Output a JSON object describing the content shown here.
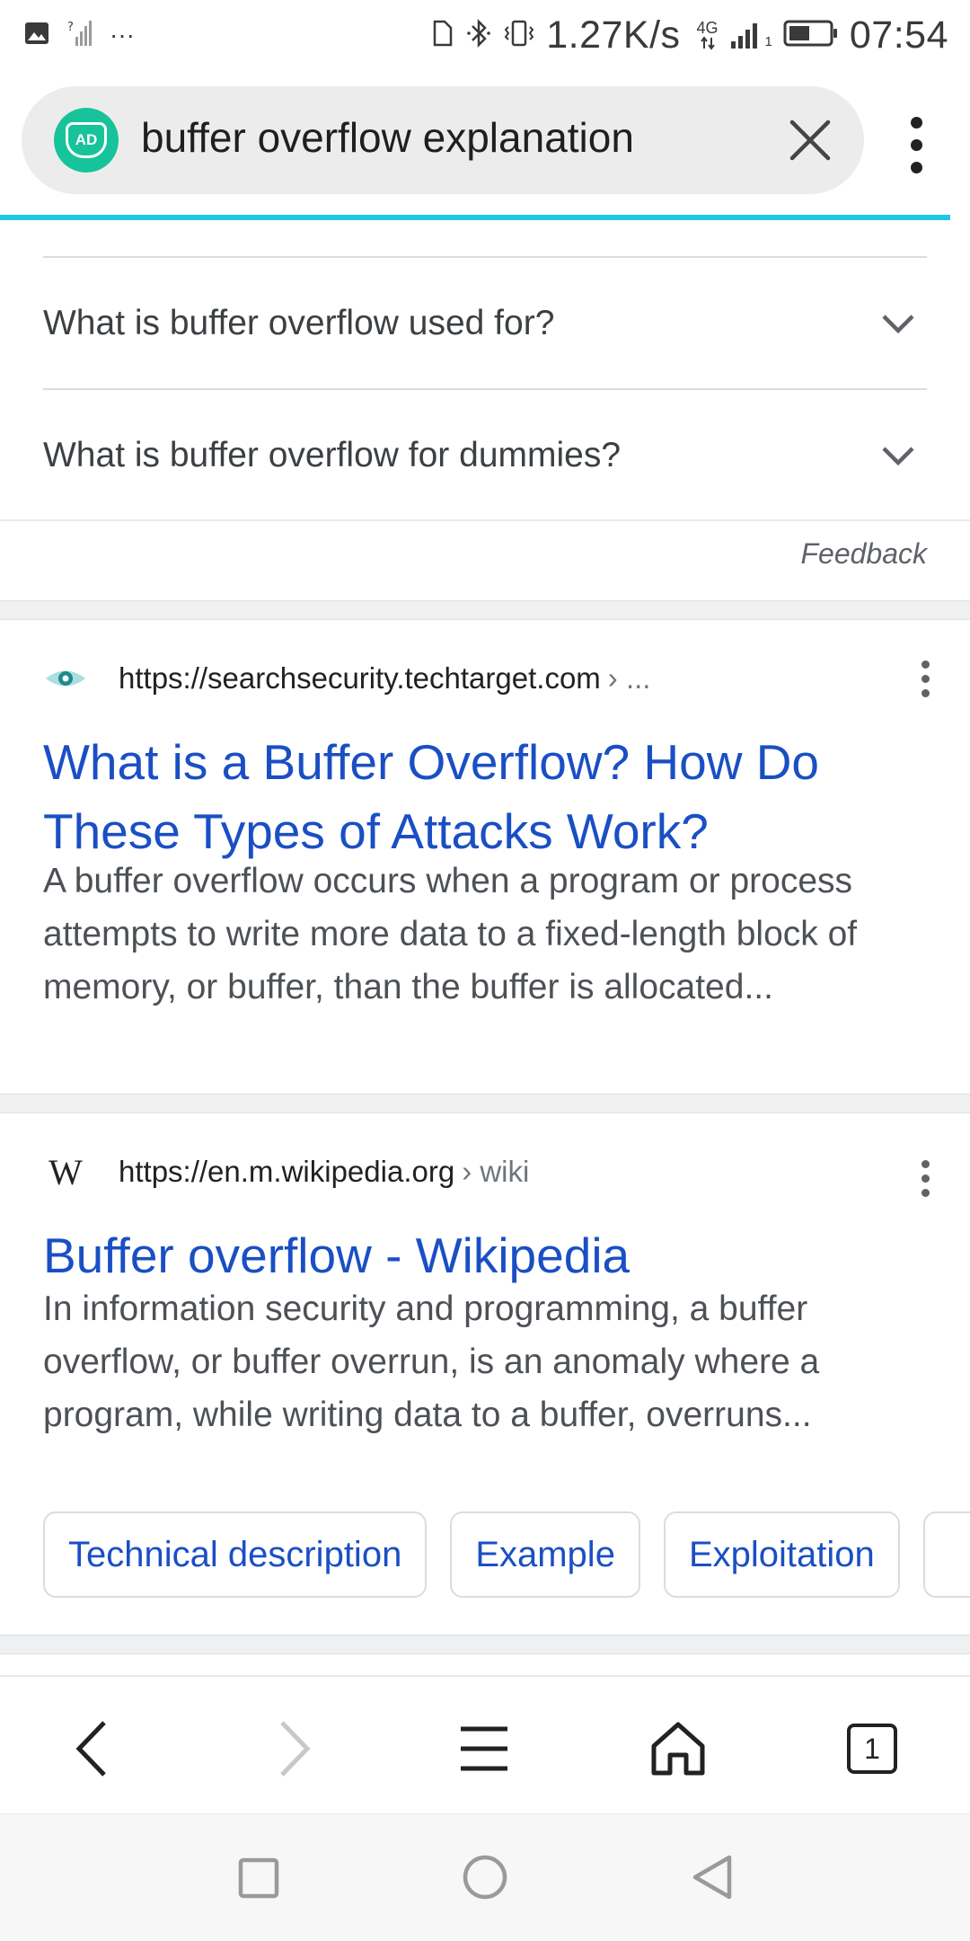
{
  "status_bar": {
    "more_indicator": "···",
    "network_speed": "1.27K/s",
    "network_type": "4G",
    "sim_slot": "1",
    "time": "07:54"
  },
  "url_bar": {
    "query": "buffer overflow explanation",
    "badge_text": "AD"
  },
  "faq": {
    "items": [
      {
        "question": "What is buffer overflow used for?"
      },
      {
        "question": "What is buffer overflow for dummies?"
      }
    ],
    "feedback_label": "Feedback"
  },
  "results": [
    {
      "source_url": "https://searchsecurity.techtarget.com",
      "breadcrumb": "› ...",
      "title": "What is a Buffer Overflow? How Do These Types of Attacks Work?",
      "snippet": "A buffer overflow occurs when a program or process attempts to write more data to a fixed-length block of memory, or buffer, than the buffer is allocated..."
    },
    {
      "source_url": "https://en.m.wikipedia.org",
      "breadcrumb": "› wiki",
      "favicon_letter": "W",
      "title": "Buffer overflow - Wikipedia",
      "snippet": "In information security and programming, a buffer overflow, or buffer overrun, is an anomaly where a program, while writing data to a buffer, overruns...",
      "chips": [
        "Technical description",
        "Example",
        "Exploitation"
      ]
    }
  ],
  "toolbar": {
    "tab_count": "1"
  },
  "colors": {
    "link_blue": "#1a4fc4",
    "progress": "#22c5e8",
    "ad_badge": "#17c39a"
  }
}
